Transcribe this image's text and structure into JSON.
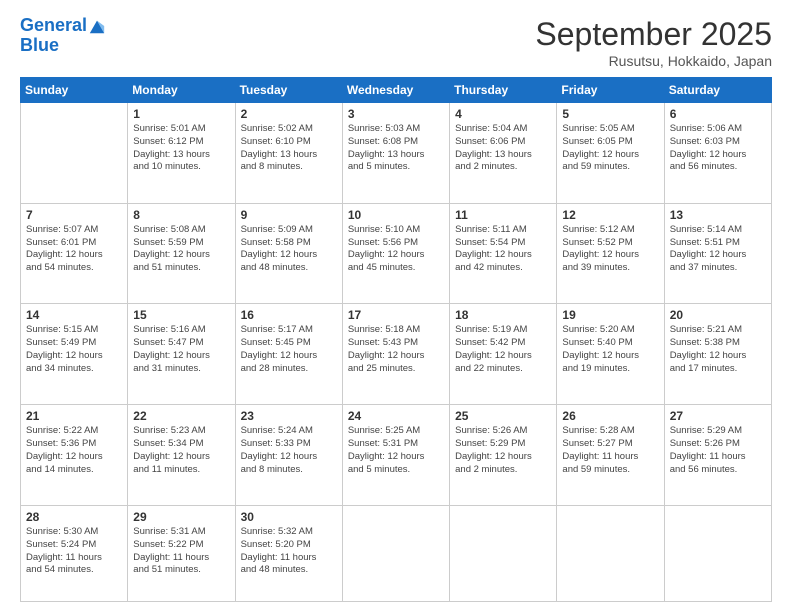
{
  "logo": {
    "line1": "General",
    "line2": "Blue"
  },
  "title": "September 2025",
  "subtitle": "Rusutsu, Hokkaido, Japan",
  "headers": [
    "Sunday",
    "Monday",
    "Tuesday",
    "Wednesday",
    "Thursday",
    "Friday",
    "Saturday"
  ],
  "weeks": [
    [
      {
        "day": "",
        "info": ""
      },
      {
        "day": "1",
        "info": "Sunrise: 5:01 AM\nSunset: 6:12 PM\nDaylight: 13 hours\nand 10 minutes."
      },
      {
        "day": "2",
        "info": "Sunrise: 5:02 AM\nSunset: 6:10 PM\nDaylight: 13 hours\nand 8 minutes."
      },
      {
        "day": "3",
        "info": "Sunrise: 5:03 AM\nSunset: 6:08 PM\nDaylight: 13 hours\nand 5 minutes."
      },
      {
        "day": "4",
        "info": "Sunrise: 5:04 AM\nSunset: 6:06 PM\nDaylight: 13 hours\nand 2 minutes."
      },
      {
        "day": "5",
        "info": "Sunrise: 5:05 AM\nSunset: 6:05 PM\nDaylight: 12 hours\nand 59 minutes."
      },
      {
        "day": "6",
        "info": "Sunrise: 5:06 AM\nSunset: 6:03 PM\nDaylight: 12 hours\nand 56 minutes."
      }
    ],
    [
      {
        "day": "7",
        "info": "Sunrise: 5:07 AM\nSunset: 6:01 PM\nDaylight: 12 hours\nand 54 minutes."
      },
      {
        "day": "8",
        "info": "Sunrise: 5:08 AM\nSunset: 5:59 PM\nDaylight: 12 hours\nand 51 minutes."
      },
      {
        "day": "9",
        "info": "Sunrise: 5:09 AM\nSunset: 5:58 PM\nDaylight: 12 hours\nand 48 minutes."
      },
      {
        "day": "10",
        "info": "Sunrise: 5:10 AM\nSunset: 5:56 PM\nDaylight: 12 hours\nand 45 minutes."
      },
      {
        "day": "11",
        "info": "Sunrise: 5:11 AM\nSunset: 5:54 PM\nDaylight: 12 hours\nand 42 minutes."
      },
      {
        "day": "12",
        "info": "Sunrise: 5:12 AM\nSunset: 5:52 PM\nDaylight: 12 hours\nand 39 minutes."
      },
      {
        "day": "13",
        "info": "Sunrise: 5:14 AM\nSunset: 5:51 PM\nDaylight: 12 hours\nand 37 minutes."
      }
    ],
    [
      {
        "day": "14",
        "info": "Sunrise: 5:15 AM\nSunset: 5:49 PM\nDaylight: 12 hours\nand 34 minutes."
      },
      {
        "day": "15",
        "info": "Sunrise: 5:16 AM\nSunset: 5:47 PM\nDaylight: 12 hours\nand 31 minutes."
      },
      {
        "day": "16",
        "info": "Sunrise: 5:17 AM\nSunset: 5:45 PM\nDaylight: 12 hours\nand 28 minutes."
      },
      {
        "day": "17",
        "info": "Sunrise: 5:18 AM\nSunset: 5:43 PM\nDaylight: 12 hours\nand 25 minutes."
      },
      {
        "day": "18",
        "info": "Sunrise: 5:19 AM\nSunset: 5:42 PM\nDaylight: 12 hours\nand 22 minutes."
      },
      {
        "day": "19",
        "info": "Sunrise: 5:20 AM\nSunset: 5:40 PM\nDaylight: 12 hours\nand 19 minutes."
      },
      {
        "day": "20",
        "info": "Sunrise: 5:21 AM\nSunset: 5:38 PM\nDaylight: 12 hours\nand 17 minutes."
      }
    ],
    [
      {
        "day": "21",
        "info": "Sunrise: 5:22 AM\nSunset: 5:36 PM\nDaylight: 12 hours\nand 14 minutes."
      },
      {
        "day": "22",
        "info": "Sunrise: 5:23 AM\nSunset: 5:34 PM\nDaylight: 12 hours\nand 11 minutes."
      },
      {
        "day": "23",
        "info": "Sunrise: 5:24 AM\nSunset: 5:33 PM\nDaylight: 12 hours\nand 8 minutes."
      },
      {
        "day": "24",
        "info": "Sunrise: 5:25 AM\nSunset: 5:31 PM\nDaylight: 12 hours\nand 5 minutes."
      },
      {
        "day": "25",
        "info": "Sunrise: 5:26 AM\nSunset: 5:29 PM\nDaylight: 12 hours\nand 2 minutes."
      },
      {
        "day": "26",
        "info": "Sunrise: 5:28 AM\nSunset: 5:27 PM\nDaylight: 11 hours\nand 59 minutes."
      },
      {
        "day": "27",
        "info": "Sunrise: 5:29 AM\nSunset: 5:26 PM\nDaylight: 11 hours\nand 56 minutes."
      }
    ],
    [
      {
        "day": "28",
        "info": "Sunrise: 5:30 AM\nSunset: 5:24 PM\nDaylight: 11 hours\nand 54 minutes."
      },
      {
        "day": "29",
        "info": "Sunrise: 5:31 AM\nSunset: 5:22 PM\nDaylight: 11 hours\nand 51 minutes."
      },
      {
        "day": "30",
        "info": "Sunrise: 5:32 AM\nSunset: 5:20 PM\nDaylight: 11 hours\nand 48 minutes."
      },
      {
        "day": "",
        "info": ""
      },
      {
        "day": "",
        "info": ""
      },
      {
        "day": "",
        "info": ""
      },
      {
        "day": "",
        "info": ""
      }
    ]
  ]
}
